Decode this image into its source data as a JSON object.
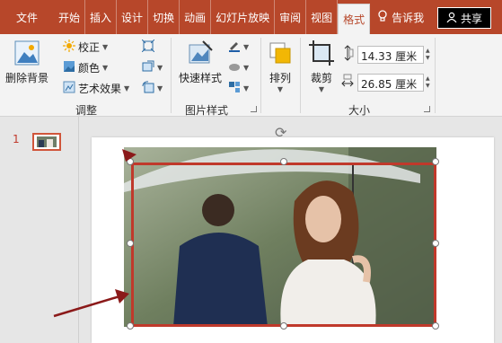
{
  "tabs": [
    "文件",
    "开始",
    "插入",
    "设计",
    "切换",
    "动画",
    "幻灯片放映",
    "审阅",
    "视图",
    "格式"
  ],
  "active_tab": "格式",
  "tell_me": "告诉我",
  "share": "共享",
  "ribbon": {
    "remove_bg": "删除背景",
    "corrections": "校正",
    "color": "颜色",
    "artistic": "艺术效果",
    "group_adjust": "调整",
    "quick_styles": "快速样式",
    "group_picture_styles": "图片样式",
    "arrange": "排列",
    "crop": "裁剪",
    "height_value": "14.33 厘米",
    "width_value": "26.85 厘米",
    "group_size": "大小"
  },
  "slide_panel": {
    "slide_number": "1"
  },
  "colors": {
    "accent": "#b7472a",
    "selection": "#c0392b"
  },
  "icons": [
    "lightbulb-icon",
    "user-icon",
    "remove-background-icon",
    "corrections-icon",
    "color-icon",
    "artistic-effects-icon",
    "compress-icon",
    "change-picture-icon",
    "reset-picture-icon",
    "quick-styles-icon",
    "picture-border-icon",
    "picture-effects-icon",
    "picture-layout-icon",
    "arrange-icon",
    "crop-icon",
    "height-icon",
    "width-icon",
    "rotate-icon"
  ]
}
